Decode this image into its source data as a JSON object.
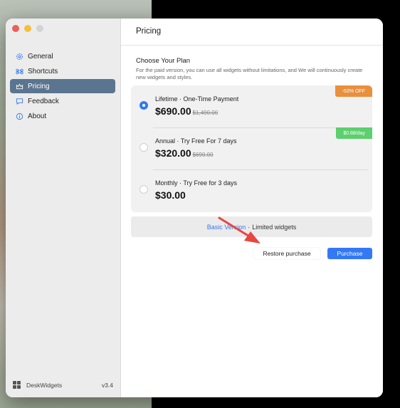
{
  "sidebar": {
    "items": [
      {
        "label": "General",
        "icon": "gear-icon",
        "active": false
      },
      {
        "label": "Shortcuts",
        "icon": "command-icon",
        "active": false
      },
      {
        "label": "Pricing",
        "icon": "crown-icon",
        "active": true
      },
      {
        "label": "Feedback",
        "icon": "chat-bubble-icon",
        "active": false
      },
      {
        "label": "About",
        "icon": "info-icon",
        "active": false
      }
    ],
    "footer": {
      "app_name": "DeskWidgets",
      "version": "v3.4",
      "icon": "widgets-grid-icon"
    }
  },
  "main": {
    "title": "Pricing",
    "section_title": "Choose Your Plan",
    "section_description": "For the paid version, you can use all widgets without limitations, and We will continuously create new widgets and styles.",
    "plans": [
      {
        "name": "Lifetime · One-Time Payment",
        "price": "$690.00",
        "old_price": "$1,490.00",
        "badge": "-53% OFF",
        "badge_color": "#e9903c",
        "selected": true
      },
      {
        "name": "Annual · Try Free For 7 days",
        "price": "$320.00",
        "old_price": "$690.00",
        "badge": "$0.88/day",
        "badge_color": "#5ccf6e",
        "selected": false
      },
      {
        "name": "Monthly · Try Free for 3 days",
        "price": "$30.00",
        "old_price": "",
        "badge": "",
        "badge_color": "",
        "selected": false
      }
    ],
    "basic": {
      "link_label": "Basic Version",
      "separator": "·",
      "text": "Limited widgets"
    },
    "buttons": {
      "restore_label": "Restore purchase",
      "purchase_label": "Purchase"
    }
  },
  "colors": {
    "accent": "#3478f6",
    "sidebar_active": "#5b7590",
    "annotation_arrow": "#e8463f"
  }
}
